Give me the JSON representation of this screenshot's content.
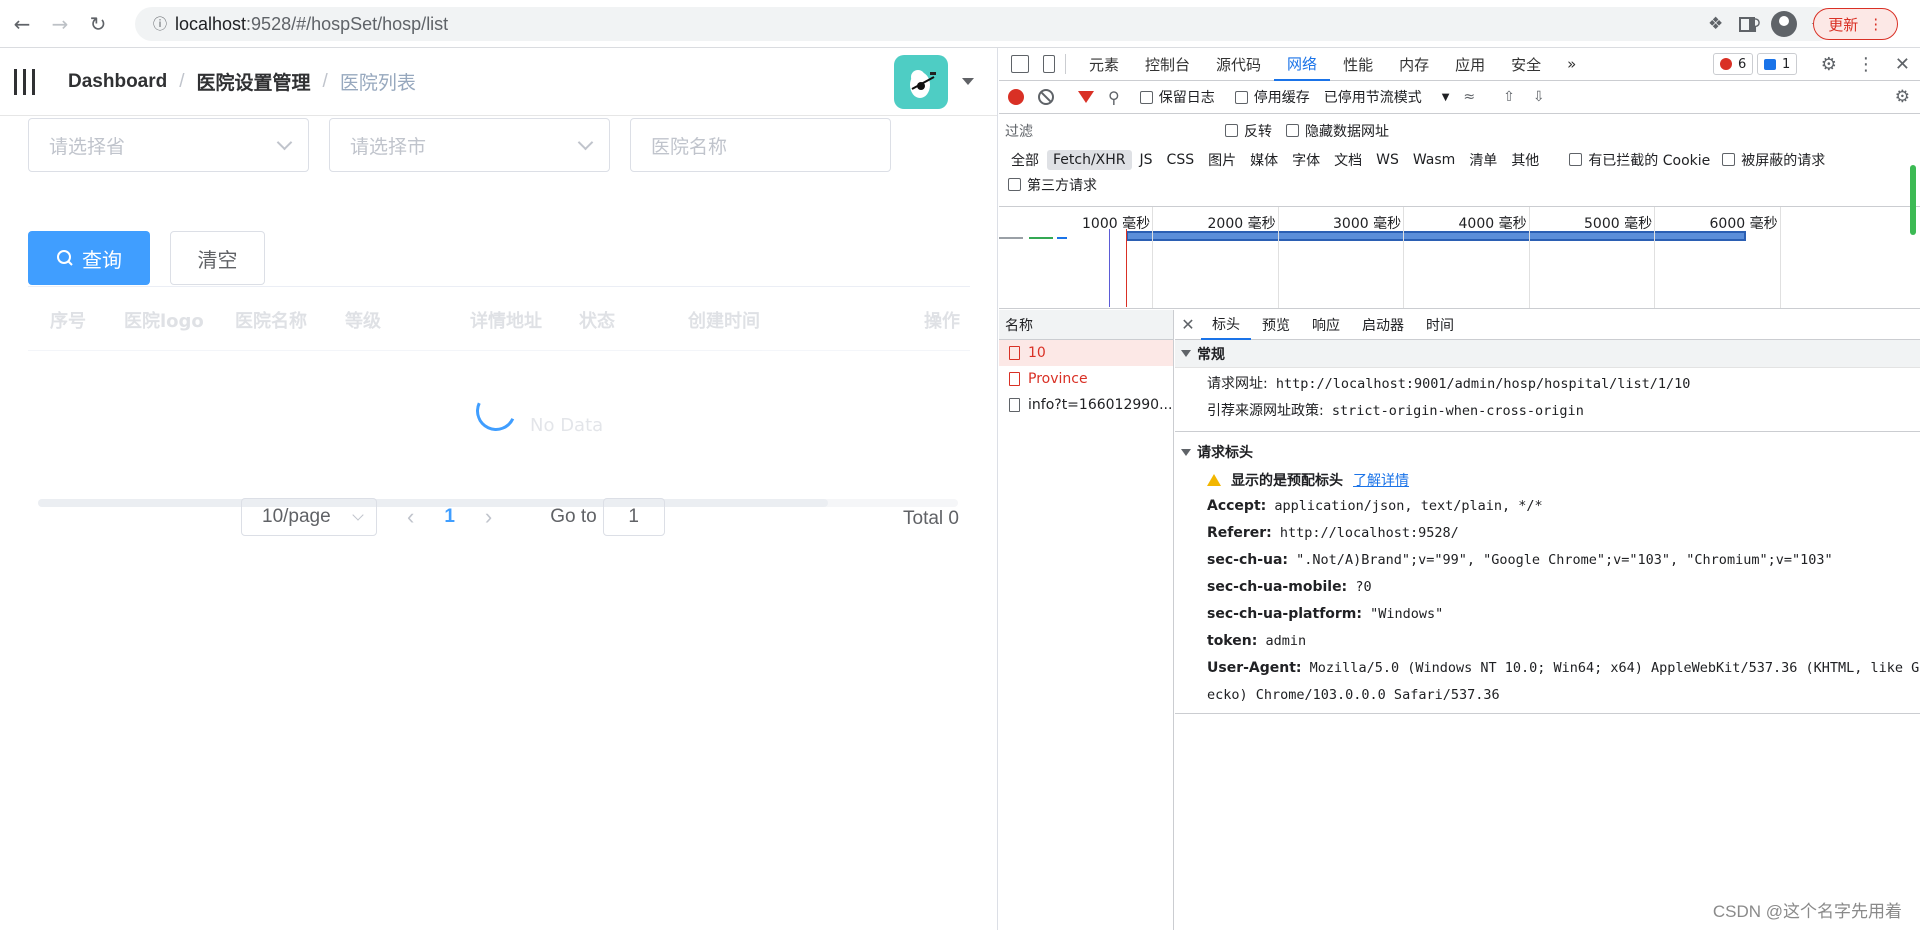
{
  "browser": {
    "url_host": "localhost",
    "url_rest": ":9528/#/hospSet/hosp/list",
    "update_label": "更新"
  },
  "app": {
    "breadcrumb": [
      "Dashboard",
      "医院设置管理",
      "医院列表"
    ],
    "filters": {
      "province_placeholder": "请选择省",
      "city_placeholder": "请选择市",
      "name_placeholder": "医院名称"
    },
    "buttons": {
      "query": "查询",
      "clear": "清空"
    },
    "table": {
      "columns": [
        "序号",
        "医院logo",
        "医院名称",
        "等级",
        "详情地址",
        "状态",
        "创建时间",
        "操作"
      ],
      "empty_text": "No Data"
    },
    "pagination": {
      "page_size": "10/page",
      "current_page": "1",
      "goto_label": "Go to",
      "goto_value": "1",
      "total": "Total 0"
    }
  },
  "devtools": {
    "tabs": [
      "元素",
      "控制台",
      "源代码",
      "网络",
      "性能",
      "内存",
      "应用",
      "安全"
    ],
    "active_tab": "网络",
    "error_count": "6",
    "message_count": "1",
    "toolbar": {
      "preserve_log": "保留日志",
      "disable_cache": "停用缓存",
      "throttle": "已停用节流模式"
    },
    "filter": {
      "placeholder": "过滤",
      "invert": "反转",
      "hide_data_urls": "隐藏数据网址"
    },
    "types": [
      "全部",
      "Fetch/XHR",
      "JS",
      "CSS",
      "图片",
      "媒体",
      "字体",
      "文档",
      "WS",
      "Wasm",
      "清单",
      "其他"
    ],
    "blocked_cookies": "有已拦截的 Cookie",
    "blocked_requests": "被屏蔽的请求",
    "third_party": "第三方请求",
    "timeline_labels": [
      "1000 毫秒",
      "2000 毫秒",
      "3000 毫秒",
      "4000 毫秒",
      "5000 毫秒",
      "6000 毫秒"
    ],
    "requests_header": "名称",
    "requests": [
      {
        "name": "10",
        "status": "error"
      },
      {
        "name": "Province",
        "status": "error"
      },
      {
        "name": "info?t=166012990...",
        "status": "ok"
      }
    ],
    "detail_tabs": [
      "标头",
      "预览",
      "响应",
      "启动器",
      "时间"
    ],
    "general": {
      "title": "常规",
      "request_url_key": "请求网址:",
      "request_url": "http://localhost:9001/admin/hosp/hospital/list/1/10",
      "referrer_policy_key": "引荐来源网址政策:",
      "referrer_policy": "strict-origin-when-cross-origin"
    },
    "request_headers": {
      "title": "请求标头",
      "warning": "显示的是预配标头",
      "learn_more": "了解详情",
      "items": [
        {
          "k": "Accept:",
          "v": "application/json, text/plain, */*"
        },
        {
          "k": "Referer:",
          "v": "http://localhost:9528/"
        },
        {
          "k": "sec-ch-ua:",
          "v": "\".Not/A)Brand\";v=\"99\", \"Google Chrome\";v=\"103\", \"Chromium\";v=\"103\""
        },
        {
          "k": "sec-ch-ua-mobile:",
          "v": "?0"
        },
        {
          "k": "sec-ch-ua-platform:",
          "v": "\"Windows\""
        },
        {
          "k": "token:",
          "v": "admin"
        },
        {
          "k": "User-Agent:",
          "v": "Mozilla/5.0 (Windows NT 10.0; Win64; x64) AppleWebKit/537.36 (KHTML, like G"
        }
      ],
      "ua_continuation": "ecko) Chrome/103.0.0.0 Safari/537.36"
    }
  },
  "watermark": "CSDN @这个名字先用着"
}
